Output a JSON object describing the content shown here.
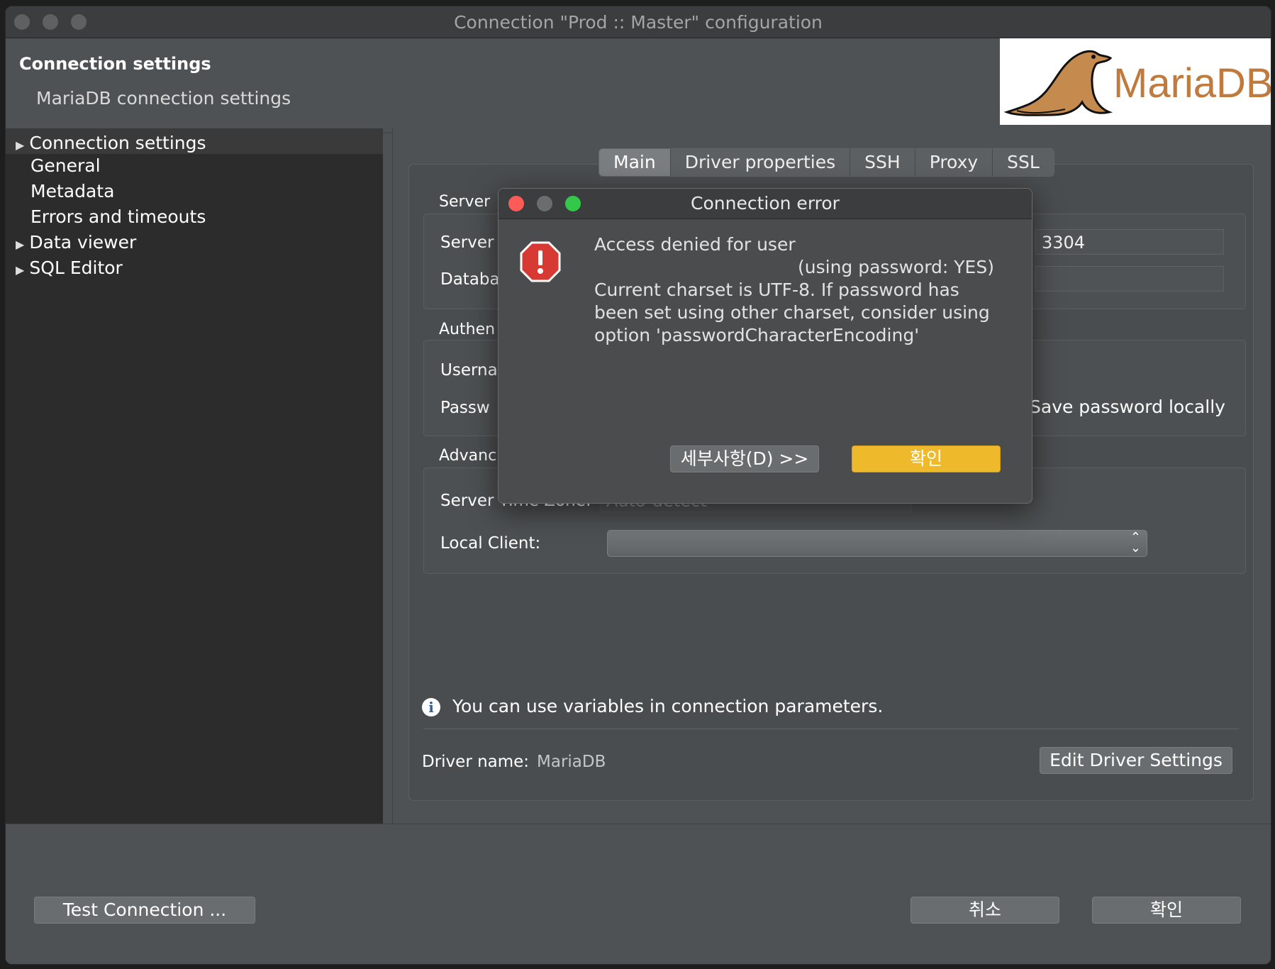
{
  "window": {
    "title": "Connection \"Prod :: Master\" configuration"
  },
  "header": {
    "title": "Connection settings",
    "subtitle": "MariaDB connection settings",
    "logo_text": "MariaDB"
  },
  "sidebar": {
    "items": [
      {
        "label": "Connection settings",
        "expandable": true,
        "selected": true
      },
      {
        "label": "General",
        "expandable": false
      },
      {
        "label": "Metadata",
        "expandable": false
      },
      {
        "label": "Errors and timeouts",
        "expandable": false
      },
      {
        "label": "Data viewer",
        "expandable": true
      },
      {
        "label": "SQL Editor",
        "expandable": true
      }
    ]
  },
  "tabs": [
    {
      "label": "Main",
      "active": true
    },
    {
      "label": "Driver properties"
    },
    {
      "label": "SSH"
    },
    {
      "label": "Proxy"
    },
    {
      "label": "SSL"
    }
  ],
  "main": {
    "server_section": "Server",
    "server_label": "Server",
    "port_value": "3304",
    "database_label": "Databa",
    "auth_section": "Authen",
    "username_label": "Userna",
    "password_label": "Passw",
    "save_password_label": "Save password locally",
    "advanced_section": "Advanc",
    "server_timezone_label": "Server Time Zone:",
    "server_timezone_value": "Auto-detect",
    "local_client_label": "Local Client:",
    "local_client_value": "",
    "info_text": "You can use variables in connection parameters.",
    "driver_name_label": "Driver name:",
    "driver_name_value": "MariaDB",
    "edit_driver_button": "Edit Driver Settings"
  },
  "footer": {
    "test_connection_button": "Test Connection ...",
    "cancel_button": "취소",
    "ok_button": "확인"
  },
  "dialog": {
    "title": "Connection error",
    "message_lines": [
      "Access denied for user",
      "(using password: YES)",
      "Current charset is UTF-8. If password has",
      "been set using other charset, consider using",
      "option 'passwordCharacterEncoding'"
    ],
    "details_button": "세부사항(D) >>",
    "ok_button": "확인"
  },
  "colors": {
    "window_bg": "#4f5254",
    "sidebar_bg": "#2c2c2c",
    "primary_button": "#efb92c",
    "close_light": "#fc5b57",
    "zoom_light": "#34c84a",
    "error_icon": "#d63a32"
  }
}
